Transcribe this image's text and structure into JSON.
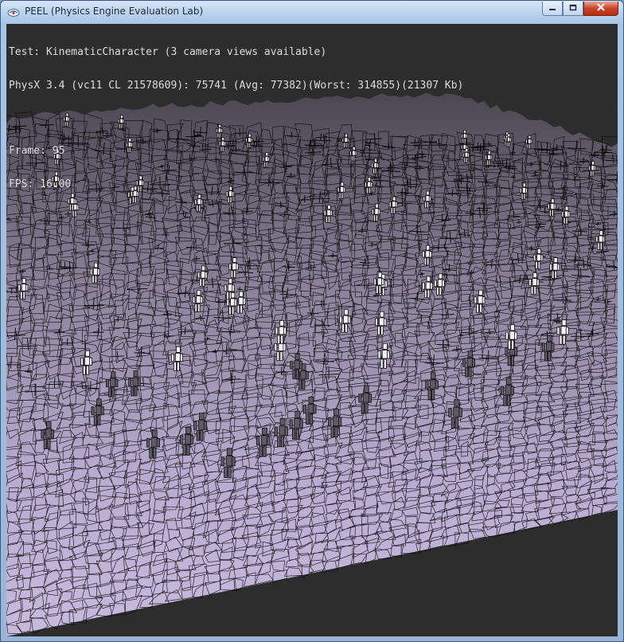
{
  "window": {
    "title": "PEEL (Physics Engine Evaluation Lab)",
    "icons": {
      "app": "peel-app-icon",
      "minimize": "minimize-icon",
      "maximize": "maximize-icon",
      "close": "close-icon"
    }
  },
  "hud": {
    "test_line": "Test: KinematicCharacter (3 camera views available)",
    "engine_line": "PhysX 3.4 (vc11 CL 21578609): 75741 (Avg: 77382)(Worst: 314855)(21307 Kb)",
    "frame_line": "Frame: 95",
    "fps_line": "FPS: 16.00"
  },
  "colors": {
    "viewport_bg": "#2d2d2d",
    "terrain_fill": "#c6bbdd",
    "terrain_edge": "#0a0a0a",
    "hud_text": "#dcdcdc",
    "titlebar": "#bad2ed",
    "close_button": "#c9462c"
  }
}
